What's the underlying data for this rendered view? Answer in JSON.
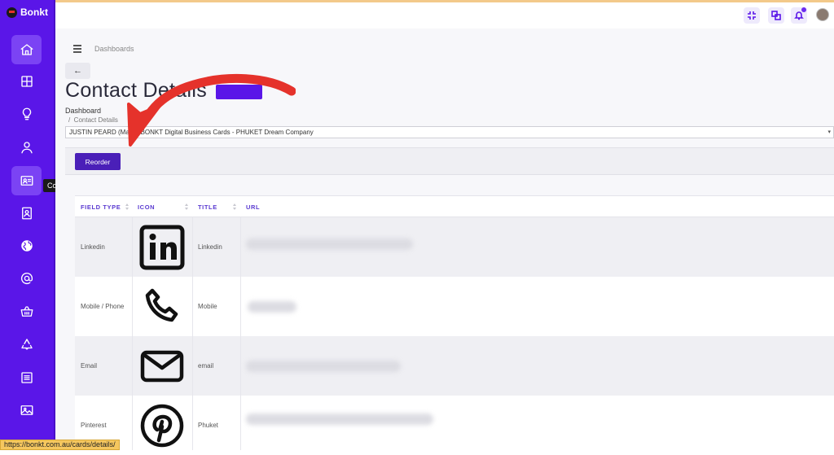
{
  "app": {
    "name": "Bonkt"
  },
  "sidebar": {
    "items": [
      {
        "name": "home",
        "icon": "home-icon"
      },
      {
        "name": "dashboards",
        "icon": "grid-icon"
      },
      {
        "name": "ideas",
        "icon": "lightbulb-icon"
      },
      {
        "name": "profile",
        "icon": "user-icon"
      },
      {
        "name": "contact-details",
        "icon": "contact-card-icon",
        "active": true
      },
      {
        "name": "address-book",
        "icon": "address-book-icon"
      },
      {
        "name": "globe",
        "icon": "globe-icon"
      },
      {
        "name": "email",
        "icon": "at-icon"
      },
      {
        "name": "shop",
        "icon": "basket-icon"
      },
      {
        "name": "recycle",
        "icon": "recycle-icon"
      },
      {
        "name": "list",
        "icon": "list-icon"
      },
      {
        "name": "gallery",
        "icon": "image-icon"
      }
    ],
    "tooltip": "Contact Details"
  },
  "topbar": {
    "icons": [
      "minimize-icon",
      "translate-icon",
      "bell-icon",
      "avatar"
    ]
  },
  "breadcrumb_top": "Dashboards",
  "page": {
    "title": "Contact Details",
    "breadcrumb": {
      "root": "Dashboard",
      "current": "Contact Details"
    },
    "select_value": "JUSTIN PEARD (Ma... - BONKT Digital Business Cards - PHUKET Dream Company",
    "reorder_label": "Reorder"
  },
  "table": {
    "columns": [
      "FIELD TYPE",
      "ICON",
      "TITLE",
      "URL"
    ],
    "rows": [
      {
        "field_type": "Linkedin",
        "icon": "linkedin-icon",
        "title": "Linkedin"
      },
      {
        "field_type": "Mobile / Phone",
        "icon": "phone-icon",
        "title": "Mobile"
      },
      {
        "field_type": "Email",
        "icon": "mail-icon",
        "title": "email"
      },
      {
        "field_type": "Pinterest",
        "icon": "pinterest-icon",
        "title": "Phuket"
      }
    ]
  },
  "statusbar": {
    "url": "https://bonkt.com.au/cards/details/"
  },
  "colors": {
    "sidebar": "#5a16e8",
    "accent": "#4a1fb8",
    "arrow": "#e5322b"
  }
}
